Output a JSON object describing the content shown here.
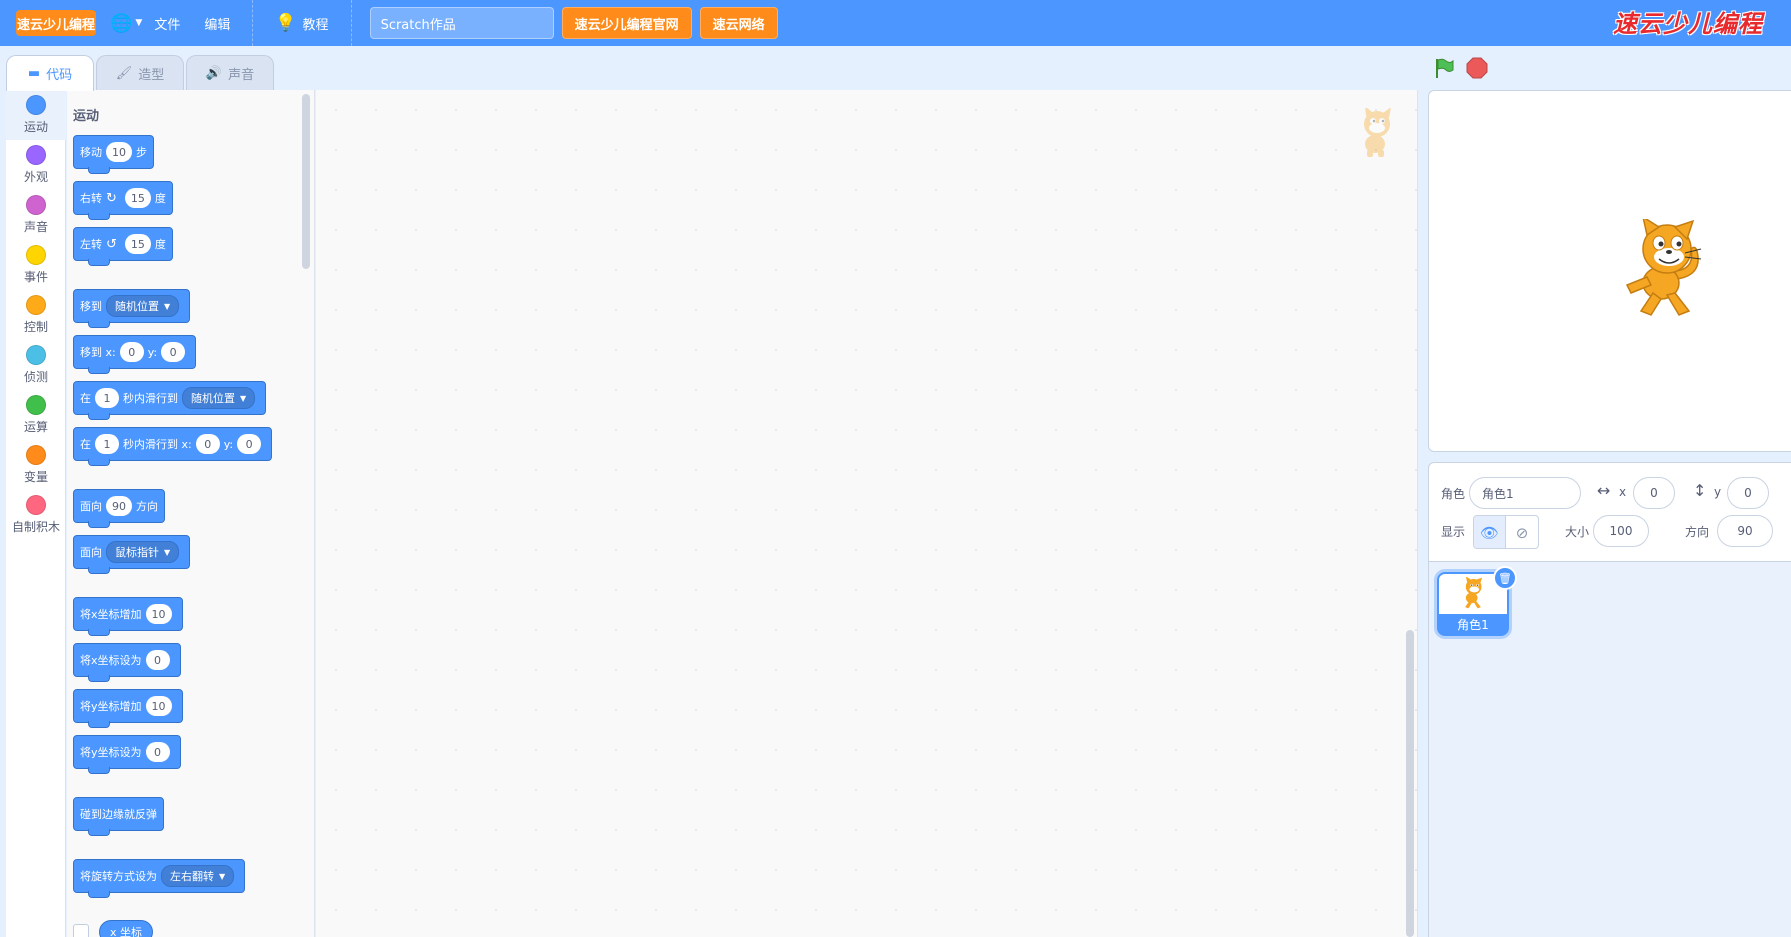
{
  "menubar": {
    "logo_text": "速云少儿编程",
    "globe_icon": "globe-icon",
    "file_label": "文件",
    "edit_label": "编辑",
    "tutorial_label": "教程",
    "project_title": "Scratch作品",
    "official_site_label": "速云少儿编程官网",
    "network_label": "速云网络",
    "brand_logo_text": "速云少儿编程"
  },
  "tabs": [
    {
      "label": "代码",
      "icon": "code-icon",
      "active": true
    },
    {
      "label": "造型",
      "icon": "brush-icon",
      "active": false
    },
    {
      "label": "声音",
      "icon": "speaker-icon",
      "active": false
    }
  ],
  "categories": [
    {
      "label": "运动",
      "color": "#4c97ff"
    },
    {
      "label": "外观",
      "color": "#9966ff"
    },
    {
      "label": "声音",
      "color": "#cf63cf"
    },
    {
      "label": "事件",
      "color": "#ffd500"
    },
    {
      "label": "控制",
      "color": "#ffab19"
    },
    {
      "label": "侦测",
      "color": "#4cbfe6"
    },
    {
      "label": "运算",
      "color": "#40bf4a"
    },
    {
      "label": "变量",
      "color": "#ff8c1a"
    },
    {
      "label": "自制积木",
      "color": "#ff6680"
    }
  ],
  "palette": {
    "section_label": "运动",
    "blocks": {
      "move": {
        "text": "移动",
        "value": "10",
        "suffix": "步"
      },
      "turn_right": {
        "text": "右转",
        "value": "15",
        "suffix": "度"
      },
      "turn_left": {
        "text": "左转",
        "value": "15",
        "suffix": "度"
      },
      "goto": {
        "text": "移到",
        "dropdown": "随机位置"
      },
      "goto_xy": {
        "text": "移到 x:",
        "x": "0",
        "y_label": "y:",
        "y": "0"
      },
      "glide": {
        "text": "在",
        "secs": "1",
        "mid": "秒内滑行到",
        "dropdown": "随机位置"
      },
      "glide_xy": {
        "text": "在",
        "secs": "1",
        "mid": "秒内滑行到 x:",
        "x": "0",
        "y_label": "y:",
        "y": "0"
      },
      "point_dir": {
        "text": "面向",
        "value": "90",
        "suffix": "方向"
      },
      "point_towards": {
        "text": "面向",
        "dropdown": "鼠标指针"
      },
      "change_x": {
        "text": "将x坐标增加",
        "value": "10"
      },
      "set_x": {
        "text": "将x坐标设为",
        "value": "0"
      },
      "change_y": {
        "text": "将y坐标增加",
        "value": "10"
      },
      "set_y": {
        "text": "将y坐标设为",
        "value": "0"
      },
      "bounce": {
        "text": "碰到边缘就反弹"
      },
      "rotation_style": {
        "text": "将旋转方式设为",
        "dropdown": "左右翻转"
      },
      "x_reporter": {
        "text": "x 坐标"
      }
    }
  },
  "stage": {
    "green_flag_icon": "green-flag-icon",
    "stop_icon": "stop-icon"
  },
  "sprite_info": {
    "sprite_label": "角色",
    "sprite_name": "角色1",
    "x_label": "x",
    "x_value": "0",
    "y_label": "y",
    "y_value": "0",
    "show_label": "显示",
    "size_label": "大小",
    "size_value": "100",
    "direction_label": "方向",
    "direction_value": "90"
  },
  "sprite_list": {
    "sprites": [
      {
        "name": "角色1",
        "selected": true
      }
    ]
  }
}
